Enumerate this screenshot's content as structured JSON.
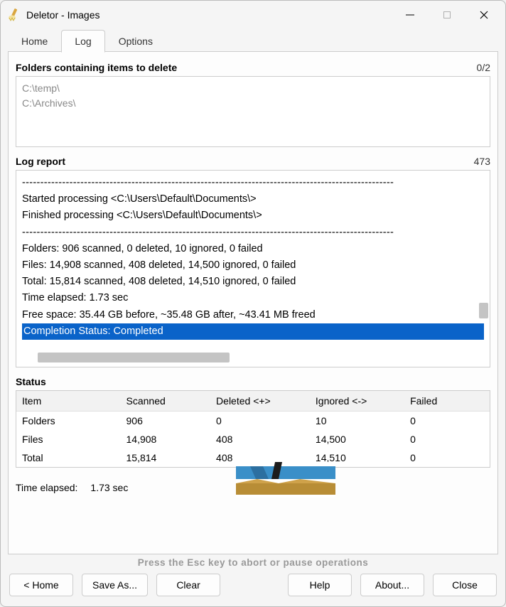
{
  "window": {
    "title": "Deletor - Images"
  },
  "tabs": {
    "home": "Home",
    "log": "Log",
    "options": "Options",
    "active": "log"
  },
  "folders": {
    "header": "Folders containing items to delete",
    "count": "0/2",
    "items": [
      "C:\\temp\\",
      "C:\\Archives\\"
    ]
  },
  "logreport": {
    "header": "Log report",
    "count": "473",
    "lines": [
      "------------------------------------------------------------------------------------------------------",
      "Started processing <C:\\Users\\Default\\Documents\\>",
      "Finished processing <C:\\Users\\Default\\Documents\\>",
      "------------------------------------------------------------------------------------------------------",
      "Folders: 906 scanned, 0 deleted, 10 ignored, 0 failed",
      "Files: 14,908 scanned, 408 deleted, 14,500 ignored, 0 failed",
      "Total: 15,814 scanned, 408 deleted, 14,510 ignored, 0 failed",
      "Time elapsed: 1.73 sec",
      "Free space: 35.44 GB before, ~35.48 GB after, ~43.41 MB freed",
      "Completion Status: Completed"
    ],
    "selected_index": 9
  },
  "status": {
    "header": "Status",
    "columns": [
      "Item",
      "Scanned",
      "Deleted <+>",
      "Ignored <->",
      "Failed"
    ],
    "rows": [
      {
        "item": "Folders",
        "scanned": "906",
        "deleted": "0",
        "ignored": "10",
        "failed": "0"
      },
      {
        "item": "Files",
        "scanned": "14,908",
        "deleted": "408",
        "ignored": "14,500",
        "failed": "0"
      },
      {
        "item": "Total",
        "scanned": "15,814",
        "deleted": "408",
        "ignored": "14,510",
        "failed": "0"
      }
    ],
    "time_label": "Time elapsed:",
    "time_value": "1.73 sec"
  },
  "hint": "Press the Esc key to abort or pause operations",
  "buttons": {
    "home": "< Home",
    "save": "Save As...",
    "clear": "Clear",
    "help": "Help",
    "about": "About...",
    "close": "Close"
  }
}
